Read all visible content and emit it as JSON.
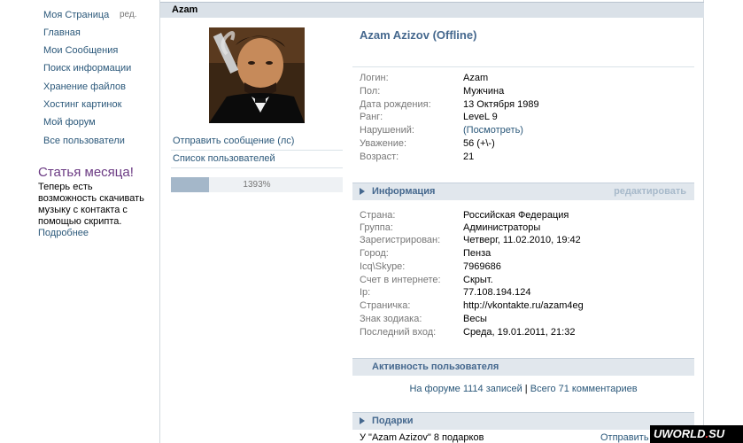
{
  "sidebar": {
    "items": [
      {
        "label": "Моя Страница"
      },
      {
        "label": "Главная"
      },
      {
        "label": "Мои Сообщения"
      },
      {
        "label": "Поиск информации"
      },
      {
        "label": "Хранение файлов"
      },
      {
        "label": "Хостинг картинок"
      },
      {
        "label": "Мой форум"
      },
      {
        "label": "Все пользователи"
      }
    ],
    "edit_label": "ред."
  },
  "article": {
    "title": "Статья месяца!",
    "text": "Теперь есть возможность скачивать музыку с контакта с помощью скрипта.",
    "more": "Подробнее"
  },
  "page": {
    "title": "Azam"
  },
  "profile": {
    "name_header": "Azam Azizov (Offline)",
    "actions": [
      "Отправить сообщение (лс)",
      "Список пользователей"
    ],
    "progress_label": "1393%",
    "progress_fraction": 0.22,
    "basic": [
      {
        "label": "Логин:",
        "value": "Azam"
      },
      {
        "label": "Пол:",
        "value": "Мужчина"
      },
      {
        "label": "Дата рождения:",
        "value": "13 Октября 1989"
      },
      {
        "label": "Ранг:",
        "value": "LeveL 9"
      },
      {
        "label": "Нарушений:",
        "value": "(Посмотреть)"
      },
      {
        "label": "Уважение:",
        "value": "56 (+\\-)"
      },
      {
        "label": "Возраст:",
        "value": "21"
      }
    ]
  },
  "info_section": {
    "title": "Информация",
    "edit": "редактировать",
    "rows": [
      {
        "label": "Страна:",
        "value": "Российская Федерация"
      },
      {
        "label": "Группа:",
        "value": "Администраторы"
      },
      {
        "label": "Зарегистрирован:",
        "value": "Четверг, 11.02.2010, 19:42"
      },
      {
        "label": "Город:",
        "value": "Пенза"
      },
      {
        "label": "Icq\\Skype:",
        "value": "7969686"
      },
      {
        "label": "Счет в интернете:",
        "value": "Скрыт."
      },
      {
        "label": "Ip:",
        "value": "77.108.194.124"
      },
      {
        "label": "Страничка:",
        "value": "http://vkontakte.ru/azam4eg"
      },
      {
        "label": "Знак зодиака:",
        "value": "Весы"
      },
      {
        "label": "Последний вход:",
        "value": "Среда, 19.01.2011, 21:32"
      }
    ]
  },
  "activity_section": {
    "title": "Активность пользователя",
    "forum": "На форуме 1114 записей",
    "separator": " | ",
    "comments": "Всего 71 комментариев"
  },
  "gifts_section": {
    "title": "Подарки",
    "summary": "У \"Azam Azizov\" 8 подарков",
    "show": "Отправить"
  },
  "watermark": {
    "text_a": "UWORLD",
    "dot": ".",
    "text_b": "SU"
  },
  "colors": {
    "link": "#2B587A",
    "header_bar": "#dae1e8",
    "section_bar": "#e1e7ed",
    "article_title": "#6b3a83"
  }
}
